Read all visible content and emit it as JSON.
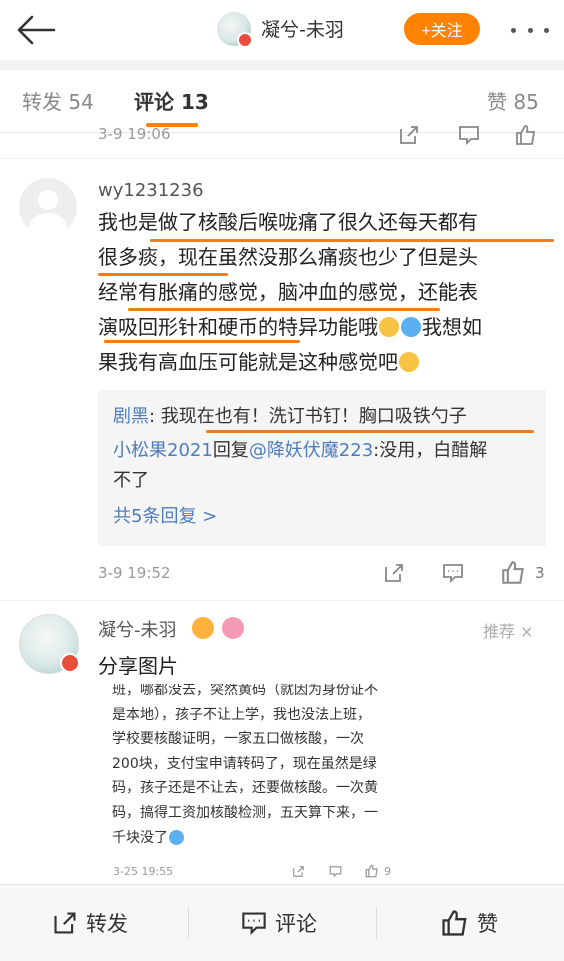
{
  "header": {
    "title": "凝兮-未羽",
    "follow_label": "+关注"
  },
  "tabs": [
    {
      "label": "转发 54"
    },
    {
      "label": "评论 13"
    },
    {
      "label": "赞 85"
    }
  ],
  "prev_comment": {
    "timestamp": "3-9 19:06"
  },
  "comment": {
    "username": "wy1231236",
    "lines": [
      "我也是做了核酸后喉咙痛了很久还每天都有",
      "很多痰，现在虽然没那么痛痰也少了但是头",
      "经常有胀痛的感觉，脑冲血的感觉，还能表",
      "演吸回形针和硬币的特异功能哦",
      "果我有高血压可能就是这种感觉吧"
    ],
    "line4_tail": "我想如",
    "timestamp": "3-9 19:52",
    "like_count": "3",
    "replies": {
      "r1_user": "剧黑",
      "r1_text": ": 我现在也有！洗订书钉！胸口吸铁勺子",
      "r2_user": "小松果2021",
      "r2_mid": "回复",
      "r2_target": "@降妖伏魔223",
      "r2_text": ":没用，白醋解",
      "r2_text_cont": "不了",
      "more_label": "共5条回复 >"
    }
  },
  "comment2": {
    "username": "凝兮-未羽",
    "recommend_label": "推荐 ×",
    "text": "分享图片",
    "image": {
      "lines": [
        "班，哪都没去，突然黄码（就因为身份证不",
        "是本地），孩子不让上学，我也没法上班，",
        "学校要核酸证明，一家五口做核酸，一次",
        "200块，支付宝申请转码了，现在虽然是绿",
        "码，孩子还是不让去，还要做核酸。一次黄",
        "码，搞得工资加核酸检测，五天算下来，一",
        "千块没了"
      ],
      "timestamp": "3-25 19:55",
      "like_count": "9"
    }
  },
  "bottom_bar": {
    "repost_label": "转发",
    "comment_label": "评论",
    "like_label": "赞"
  },
  "colors": {
    "accent": "#ff8200",
    "link": "#4d7dbd",
    "underline": "#f07c1c"
  }
}
